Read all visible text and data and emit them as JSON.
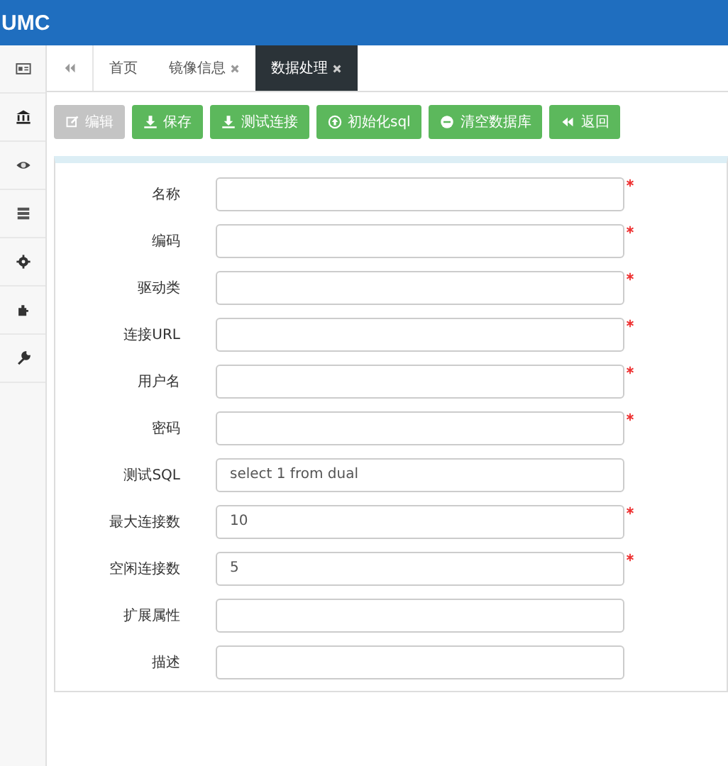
{
  "header": {
    "logo": "UMC"
  },
  "sidebar": {
    "items": [
      {
        "selected": false
      },
      {
        "selected": false
      },
      {
        "selected": false
      },
      {
        "selected": false
      },
      {
        "selected": false
      },
      {
        "selected": false
      },
      {
        "selected": false
      }
    ]
  },
  "tabs": [
    {
      "label": "首页",
      "closable": false,
      "selected": false
    },
    {
      "label": "镜像信息",
      "closable": true,
      "selected": false
    },
    {
      "label": "数据处理",
      "closable": true,
      "selected": true
    }
  ],
  "toolbar": [
    {
      "label": "编辑",
      "disabled": true
    },
    {
      "label": "保存",
      "disabled": false
    },
    {
      "label": "测试连接",
      "disabled": false
    },
    {
      "label": "初始化sql",
      "disabled": false
    },
    {
      "label": "清空数据库",
      "disabled": false
    },
    {
      "label": "返回",
      "disabled": false
    }
  ],
  "form": [
    {
      "label": "名称",
      "required": true
    },
    {
      "label": "编码",
      "required": true
    },
    {
      "label": "驱动类",
      "required": true
    },
    {
      "label": "连接URL",
      "required": true
    },
    {
      "label": "用户名",
      "required": true
    },
    {
      "label": "密码",
      "required": true
    },
    {
      "label": "测试SQL",
      "value": "select 1 from dual",
      "required": false
    },
    {
      "label": "最大连接数",
      "value": "10",
      "required": true
    },
    {
      "label": "空闲连接数",
      "value": "5",
      "required": true
    },
    {
      "label": "扩展属性",
      "required": false
    },
    {
      "label": "描述",
      "required": false
    }
  ]
}
